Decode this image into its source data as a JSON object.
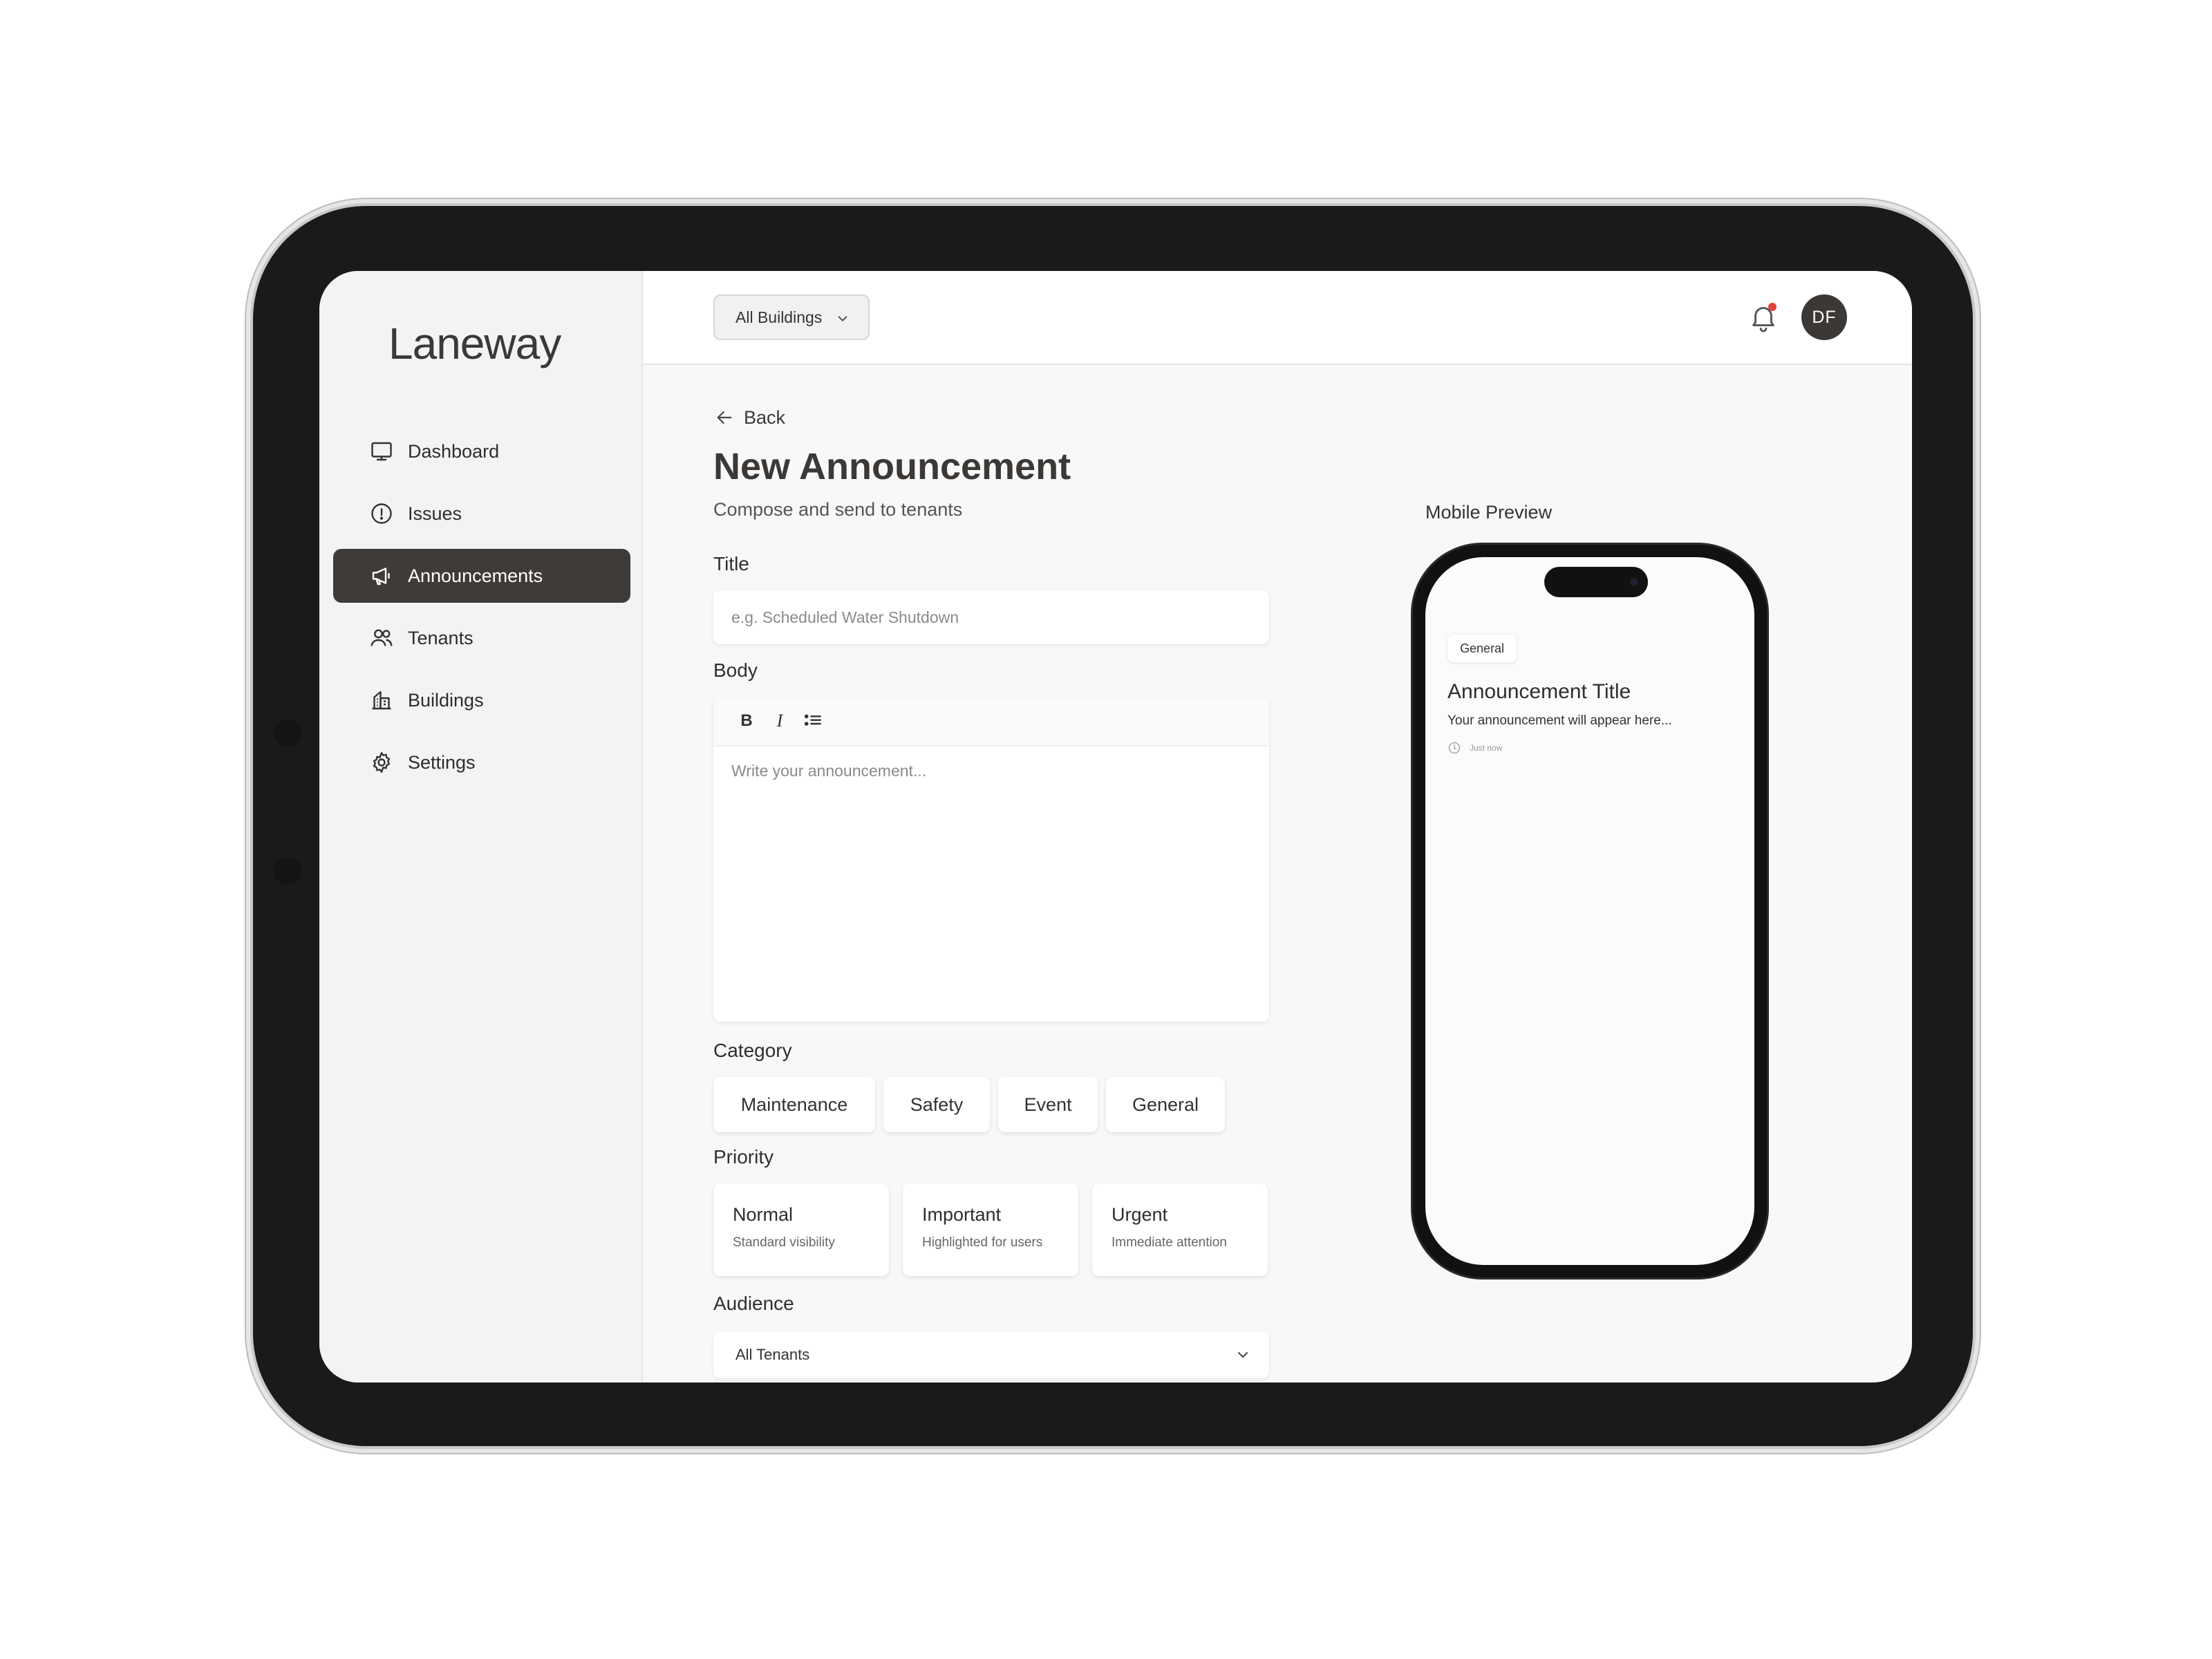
{
  "app": {
    "brand": "Laneway"
  },
  "sidebar": {
    "items": [
      {
        "label": "Dashboard",
        "icon": "dashboard-icon",
        "active": false
      },
      {
        "label": "Issues",
        "icon": "alert-circle-icon",
        "active": false
      },
      {
        "label": "Announcements",
        "icon": "megaphone-icon",
        "active": true
      },
      {
        "label": "Tenants",
        "icon": "users-icon",
        "active": false
      },
      {
        "label": "Buildings",
        "icon": "building-icon",
        "active": false
      },
      {
        "label": "Settings",
        "icon": "gear-icon",
        "active": false
      }
    ]
  },
  "topbar": {
    "building_filter": "All Buildings",
    "avatar_initials": "DF",
    "notifications_unread": true
  },
  "page": {
    "back_label": "Back",
    "title": "New Announcement",
    "subtitle": "Compose and send to tenants"
  },
  "form": {
    "title_label": "Title",
    "title_placeholder": "e.g. Scheduled Water Shutdown",
    "body_label": "Body",
    "body_placeholder": "Write your announcement...",
    "toolbar": {
      "bold": "B",
      "italic": "I"
    },
    "category_label": "Category",
    "categories": [
      "Maintenance",
      "Safety",
      "Event",
      "General"
    ],
    "priority_label": "Priority",
    "priorities": [
      {
        "title": "Normal",
        "desc": "Standard visibility"
      },
      {
        "title": "Important",
        "desc": "Highlighted for users"
      },
      {
        "title": "Urgent",
        "desc": "Immediate attention"
      }
    ],
    "audience_label": "Audience",
    "audience_value": "All Tenants"
  },
  "preview": {
    "label": "Mobile Preview",
    "badge": "General",
    "title": "Announcement Title",
    "body": "Your announcement will appear here...",
    "time": "Just now"
  },
  "colors": {
    "accent": "#3f3b38",
    "notification": "#e0453a",
    "background": "#f8f8f8"
  }
}
